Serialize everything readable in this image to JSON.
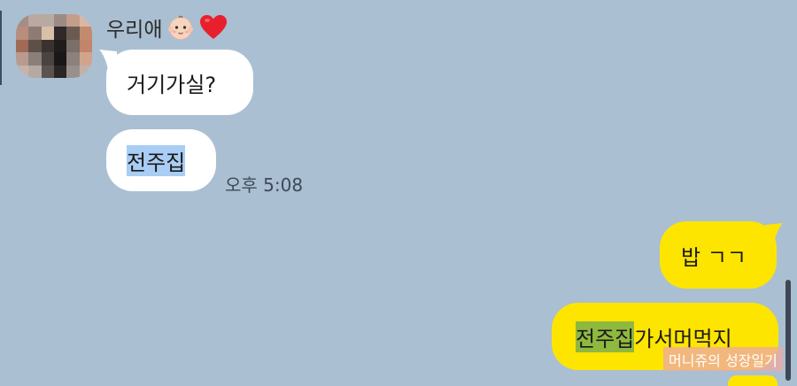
{
  "chat": {
    "sender": {
      "name": "우리애",
      "emoji_icons": [
        "baby-face-icon",
        "red-heart-icon"
      ]
    },
    "incoming": [
      {
        "text": "거기가실?"
      },
      {
        "text": "전주집",
        "highlighted": true
      }
    ],
    "timestamp": "오후 5:08",
    "outgoing": [
      {
        "text": "밥 ㄱㄱ"
      },
      {
        "highlight": "전주집",
        "rest": "가서머먹지"
      }
    ],
    "watermark": "머니쥬의 성장일기",
    "colors": {
      "background": "#aabfd2",
      "incoming_bubble": "#ffffff",
      "outgoing_bubble": "#fee500",
      "selection_highlight": "#a9cdf4",
      "selection_highlight_on_yellow": "#8fb83f"
    }
  }
}
